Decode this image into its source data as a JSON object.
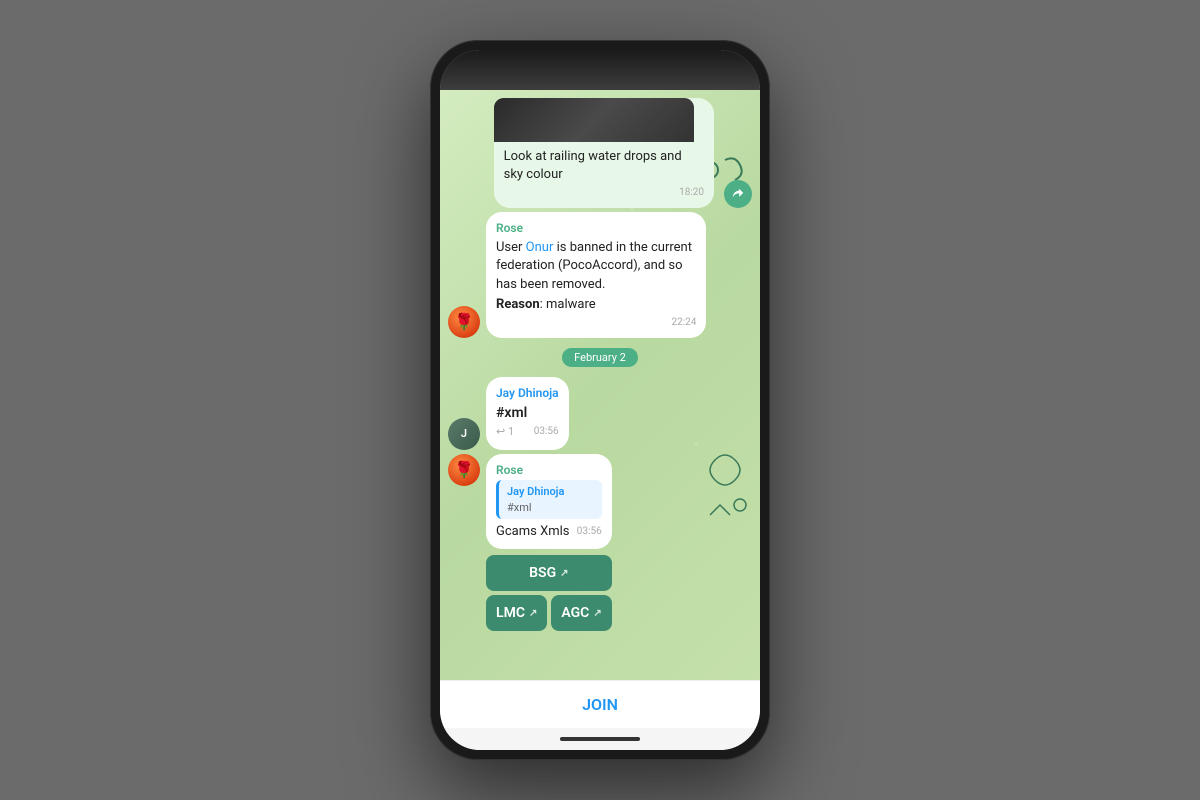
{
  "phone": {
    "messages": [
      {
        "id": "msg1",
        "type": "photo_text",
        "sender": "unknown",
        "text": "Look at railing water drops and sky colour",
        "time": "18:20",
        "side": "right",
        "hasForward": true
      },
      {
        "id": "msg2",
        "type": "text",
        "sender": "Rose",
        "sender_color": "green",
        "mention": "Onur",
        "text_before": "User ",
        "text_middle": "Onur",
        "text_after": " is banned in the current federation (PocoAccord), and so has been removed.",
        "reason_label": "Reason",
        "reason": ": malware",
        "time": "22:24",
        "side": "left"
      },
      {
        "id": "date_sep",
        "type": "date",
        "label": "February 2"
      },
      {
        "id": "msg3",
        "type": "text",
        "sender": "Jay Dhinoja",
        "sender_color": "blue",
        "text": "#xml",
        "reply_count": "↩ 1",
        "time": "03:56",
        "side": "left"
      },
      {
        "id": "msg4",
        "type": "reply_text",
        "sender": "Rose",
        "sender_color": "green",
        "reply_to_sender": "Jay Dhinoja",
        "reply_to_text": "#xml",
        "text": "Gcams Xmls",
        "time": "03:56",
        "side": "left",
        "buttons": {
          "full": "BSG",
          "half1": "LMC",
          "half2": "AGC"
        }
      }
    ],
    "bottom_bar": {
      "join_label": "JOIN"
    }
  }
}
